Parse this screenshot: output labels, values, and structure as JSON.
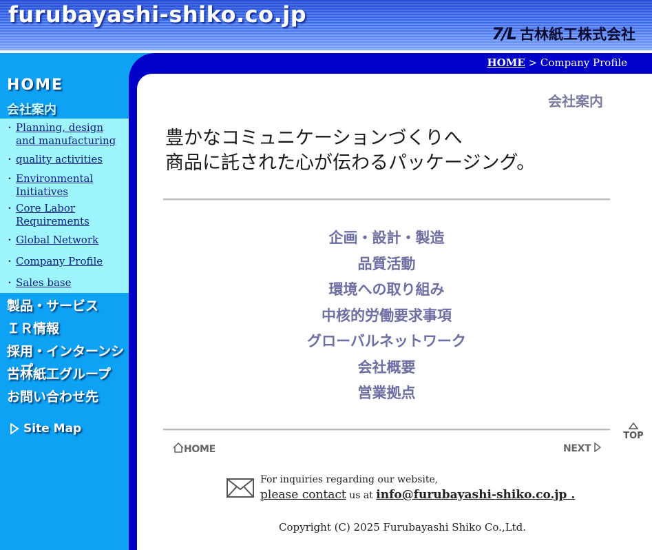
{
  "header": {
    "site_title": "furubayashi-shiko.co.jp",
    "brand_mark": "7/L",
    "brand_name": "古林紙工株式会社"
  },
  "breadcrumb": {
    "home": "HOME",
    "separator": " > ",
    "current": "Company Profile"
  },
  "sidebar": {
    "home": "HOME",
    "current_section": "会社案内",
    "subitems": [
      "Planning, design and manufacturing",
      "quality activities",
      "Environmental Initiatives",
      "Core Labor Requirements",
      "Global Network",
      "Company Profile",
      "Sales base"
    ],
    "bullet": "・",
    "categories": [
      "製品・サービス",
      "ＩＲ情報",
      "採用・インターンシップ",
      "古林紙工グループ",
      "お問い合わせ先"
    ],
    "sitemap_icon": "triangle-right-outline-icon",
    "sitemap": "Site Map"
  },
  "main": {
    "page_title": "会社案内",
    "headline_line1": "豊かなコミュニケーションづくりへ",
    "headline_line2": "商品に託された心が伝わるパッケージング。",
    "menu": [
      "企画・設計・製造",
      "品質活動",
      "環境への取り組み",
      "中核的労働要求事項",
      "グローバルネットワーク",
      "会社概要",
      "営業拠点"
    ]
  },
  "footer": {
    "top_label": "TOP",
    "home_label": "HOME",
    "next_label": "NEXT",
    "contact_intro": "For inquiries regarding our website,",
    "please_contact": "please contact",
    "us_at": "us at",
    "email": "info@furubayashi-shiko.co.jp .",
    "copyright": "Copyright (C) 2025 Furubayashi Shiko Co.,Ltd."
  },
  "colors": {
    "sidebar": "#0ea2f5",
    "submenu": "#9ff5fd",
    "band": "#0000c8",
    "menu_link": "#6d6ea3"
  }
}
